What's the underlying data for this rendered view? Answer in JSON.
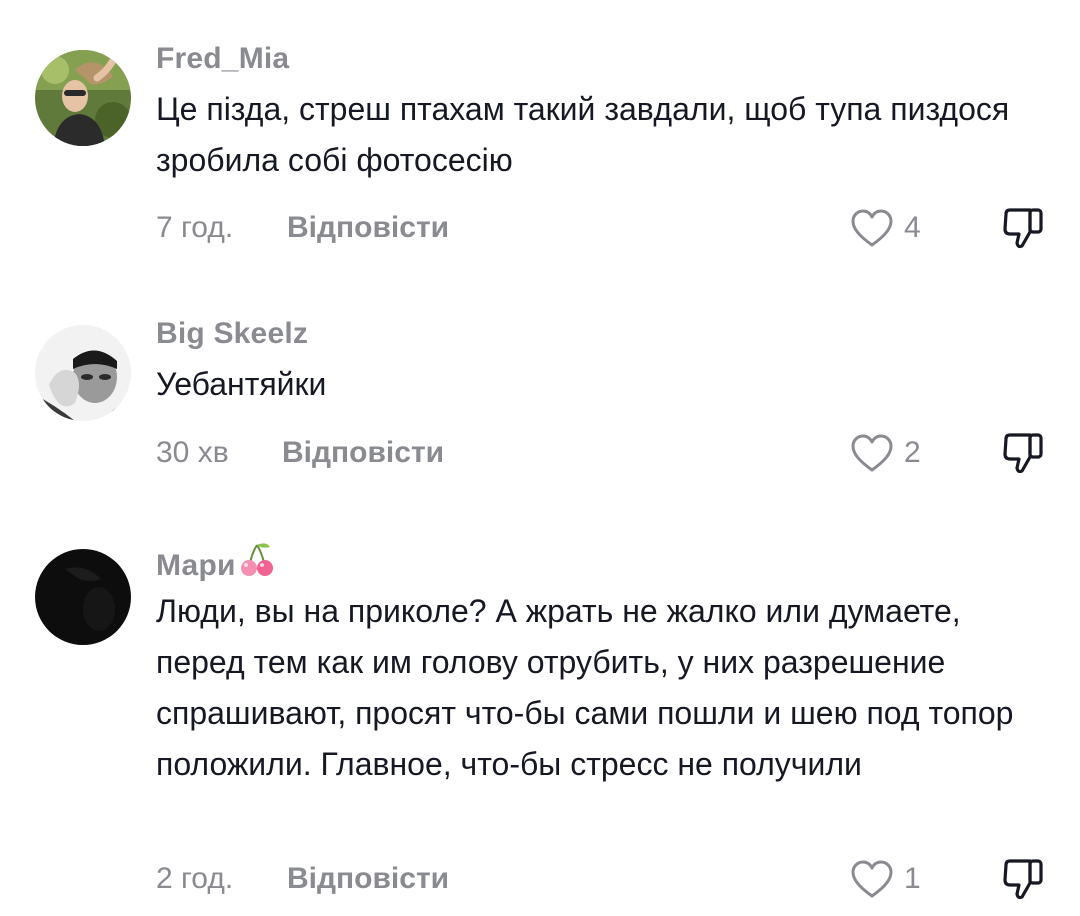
{
  "comments": [
    {
      "username": "Fred_Mia",
      "avatar_icon": "user-avatar-photo-woman",
      "text": "Це пізда, стреш птахам такий завдали, щоб тупа пиздося зробила собі фотосесію",
      "time": "7 год.",
      "reply_label": "Відповісти",
      "likes": "4"
    },
    {
      "username": "Big Skeelz",
      "avatar_icon": "user-avatar-photo-man-bw",
      "text": "Уебантяйки",
      "time": "30 хв",
      "reply_label": "Відповісти",
      "likes": "2"
    },
    {
      "username": "Мари",
      "username_emoji": "cherry-emoji",
      "avatar_icon": "user-avatar-dark",
      "text": "Люди, вы на приколе? А жрать не жалко или думаете, перед тем как им голову отрубить, у них разрешение спрашивают, просят что-бы сами пошли и шею под топор положили. Главное, что-бы стресс не получили",
      "time": "2 год.",
      "reply_label": "Відповісти",
      "likes": "1"
    }
  ],
  "icons": {
    "like": "heart-outline-icon",
    "dislike": "thumbs-down-outline-icon"
  },
  "colors": {
    "text": "#161823",
    "muted": "#8a8b91",
    "background": "#ffffff"
  }
}
